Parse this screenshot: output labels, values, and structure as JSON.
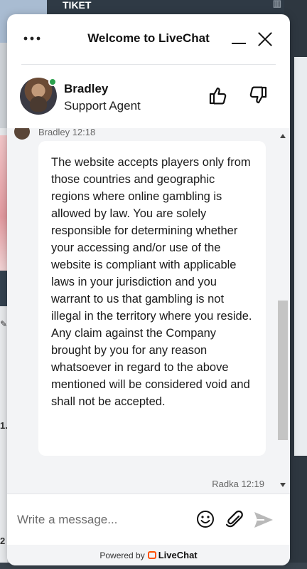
{
  "background": {
    "top_bar_label": "TIKET",
    "left_mark_1": "1.",
    "left_mark_2": "2"
  },
  "header": {
    "title": "Welcome to LiveChat",
    "menu_icon": "more-horizontal-icon",
    "minimize_icon": "minimize-icon",
    "close_icon": "close-icon"
  },
  "agent": {
    "name": "Bradley",
    "role": "Support Agent",
    "status_color": "#2ca24e"
  },
  "messages": {
    "first_meta": "Bradley 12:18",
    "first_text": "The website accepts players only from those countries and geographic regions where online gambling is allowed by law. You are solely responsible for determining whether your accessing and/or use of the website is compliant with applicable laws in your jurisdiction and you warrant to us that gambling is not illegal in the territory where you reside. Any claim against the Company brought by you for any reason whatsoever in regard to the above mentioned will be considered void and shall not be accepted.",
    "second_meta": "Radka 12:19"
  },
  "composer": {
    "placeholder": "Write a message..."
  },
  "footer": {
    "powered_by": "Powered by",
    "brand": "LiveChat",
    "brand_color": "#ff5100"
  }
}
